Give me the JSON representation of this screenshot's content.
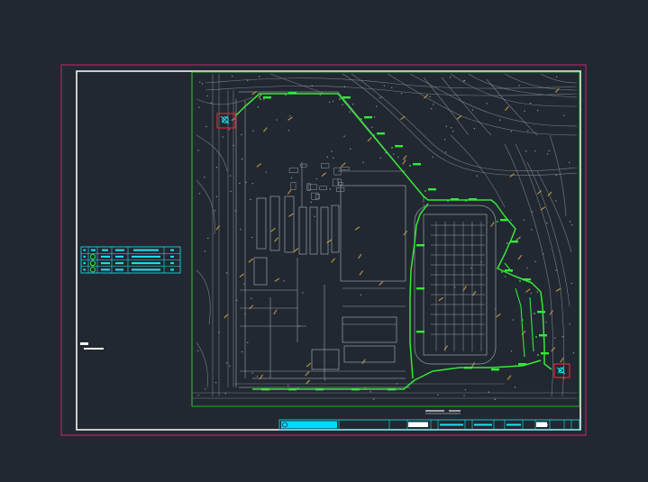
{
  "app": {
    "background": "#222831"
  },
  "colors": {
    "sheet_border": "#b0245e",
    "inner_border": "#f2f2f2",
    "site_frame": "#29c229",
    "basemap_lines": "#8c8f94",
    "building_lines": "#9aa0a6",
    "pipeline": "#35e83a",
    "pipeline_labels": "#35e83a",
    "terrain_marks": "#b4b7bb",
    "annotation_marks": "#c9a24a",
    "legend_cyan": "#19e6f0",
    "title_block_cyan": "#19e6f0",
    "title_block_fill": "#00d9ff",
    "marker_red": "#e0263b",
    "marker_cyan": "#19e6f0"
  },
  "icons": {
    "start_marker": "valve-icon",
    "end_marker": "valve-icon"
  },
  "sheet": {
    "legend_rows": 3,
    "title_block_cells": 10
  }
}
